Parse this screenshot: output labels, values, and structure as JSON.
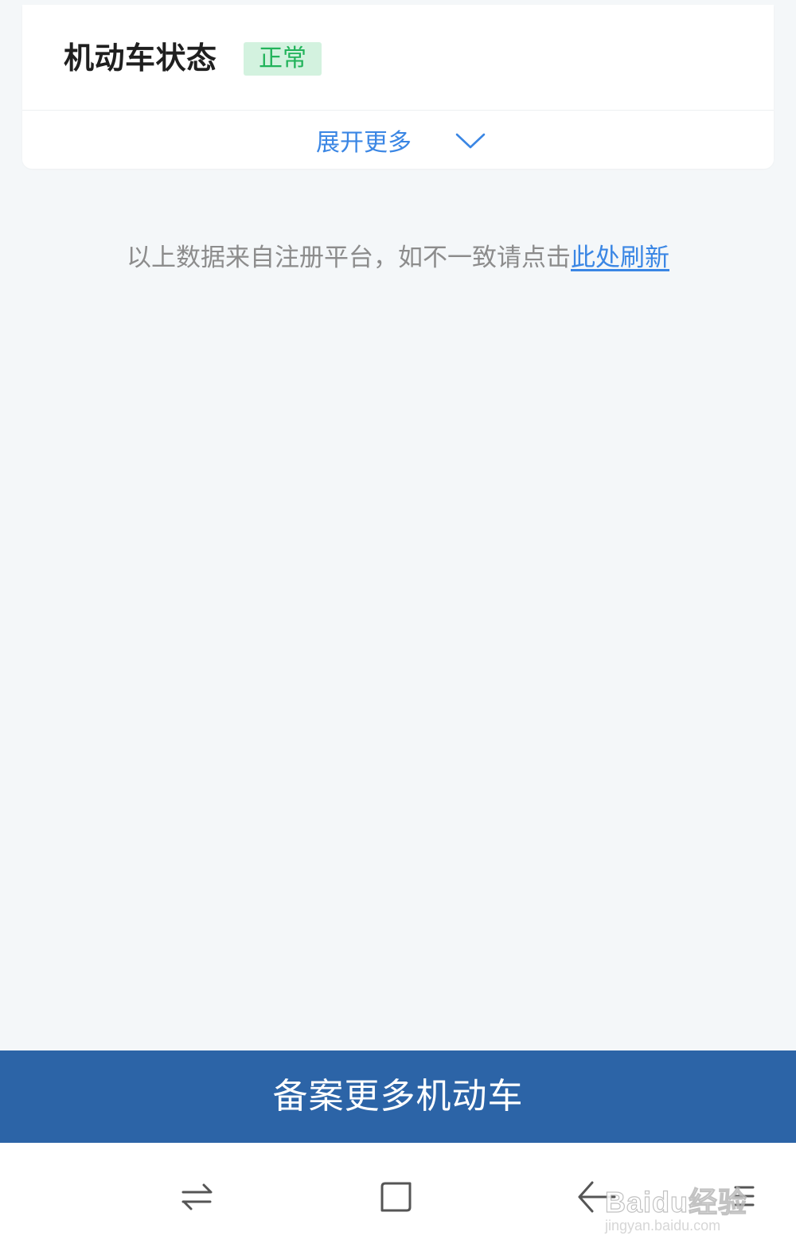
{
  "vehicle_card": {
    "status_label": "机动车状态",
    "status_badge": "正常",
    "expand_label": "展开更多"
  },
  "note": {
    "text": "以上数据来自注册平台，如不一致请点击",
    "link_text": "此处刷新"
  },
  "primary_action": {
    "label": "备案更多机动车"
  },
  "watermark": {
    "brand": "Baidu经验",
    "url": "jingyan.baidu.com"
  },
  "icons": {
    "expand": "chevron-down-icon",
    "recent_apps": "swap-arrows-icon",
    "home": "square-icon",
    "back": "back-arrow-icon",
    "menu": "menu-icon"
  },
  "colors": {
    "accent": "#3a86e4",
    "button": "#2c64a7",
    "badge_bg": "#d3f2df",
    "badge_text": "#21b35a",
    "page_bg": "#f4f7f9"
  }
}
